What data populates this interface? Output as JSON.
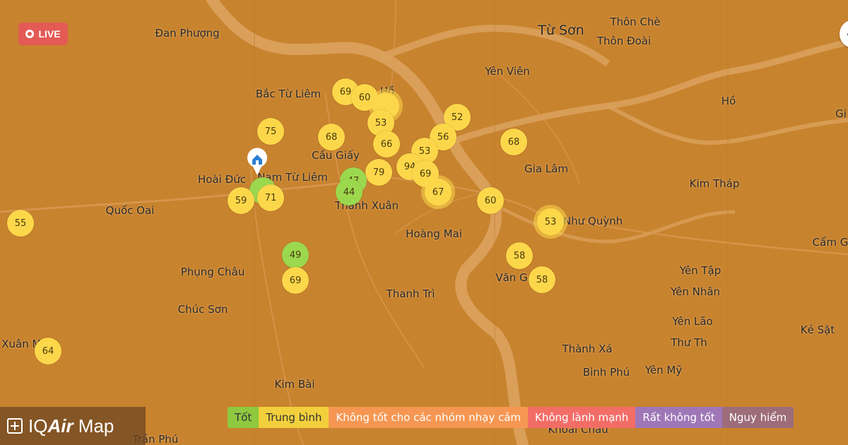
{
  "live_badge": "LIVE",
  "brand": {
    "iq": "IQ",
    "air": "Air",
    "map": " Map"
  },
  "colors": {
    "map_bg": "#c8832e",
    "river": "#dba25e",
    "good": "#9cd84e",
    "moderate": "#fdd74a",
    "usg": "#fe9b57",
    "unhealthy": "#fe6a69",
    "very_unhealthy": "#a97abc",
    "hazardous": "#a87383"
  },
  "legend": [
    {
      "label": "Tốt",
      "color": "#8ec93f",
      "text": "dark"
    },
    {
      "label": "Trung bình",
      "color": "#f2cf3c",
      "text": "dark"
    },
    {
      "label": "Không tốt cho các nhóm nhạy cảm",
      "color": "#f59752",
      "text": "light"
    },
    {
      "label": "Không lành mạnh",
      "color": "#f36d67",
      "text": "light"
    },
    {
      "label": "Rất không tốt",
      "color": "#9f77b7",
      "text": "light"
    },
    {
      "label": "Nguy hiểm",
      "color": "#9d6d7b",
      "text": "light"
    }
  ],
  "places": [
    {
      "name": "Đan Phượng",
      "big": false
    },
    {
      "name": "Bắc Từ Liêm",
      "big": false
    },
    {
      "name": "Hồ",
      "big": false
    },
    {
      "name": "Từ Sơn",
      "big": true
    },
    {
      "name": "Thôn Chè",
      "big": false
    },
    {
      "name": "Thôn Đoài",
      "big": false
    },
    {
      "name": "Yên Viên",
      "big": false
    },
    {
      "name": "Hồ",
      "big": false
    },
    {
      "name": "Gi",
      "big": false
    },
    {
      "name": "Cầu Giấy",
      "big": false
    },
    {
      "name": "Hoài Đức",
      "big": false
    },
    {
      "name": "Nam Từ Liêm",
      "big": false
    },
    {
      "name": "Gia Lâm",
      "big": false
    },
    {
      "name": "Kim Tháp",
      "big": false
    },
    {
      "name": "Quốc Oai",
      "big": false
    },
    {
      "name": "Thanh Xuân",
      "big": false
    },
    {
      "name": "Như Quỳnh",
      "big": false
    },
    {
      "name": "Hoàng Mai",
      "big": false
    },
    {
      "name": "Cẩm G",
      "big": false
    },
    {
      "name": "Phụng Châu",
      "big": false
    },
    {
      "name": "Văn G",
      "big": false
    },
    {
      "name": "Yên Tập",
      "big": false
    },
    {
      "name": "Thanh Trì",
      "big": false
    },
    {
      "name": "Yên Nhân",
      "big": false
    },
    {
      "name": "Chúc Sơn",
      "big": false
    },
    {
      "name": "Yên Lão",
      "big": false
    },
    {
      "name": "Kẻ Sặt",
      "big": false
    },
    {
      "name": "Thư Th",
      "big": false
    },
    {
      "name": "Xuân Mai",
      "big": false
    },
    {
      "name": "Thành Xá",
      "big": false
    },
    {
      "name": "Bình Phú",
      "big": false
    },
    {
      "name": "Yên Mỹ",
      "big": false
    },
    {
      "name": "Kim Bài",
      "big": false
    },
    {
      "name": "Khoái Châu",
      "big": false
    },
    {
      "name": "Trần Phú",
      "big": false
    }
  ],
  "stations": [
    {
      "aqi": "69",
      "level": "moderate"
    },
    {
      "aqi": "60",
      "level": "moderate"
    },
    {
      "aqi": "",
      "level": "moderate"
    },
    {
      "aqi": "53",
      "level": "moderate"
    },
    {
      "aqi": "52",
      "level": "moderate"
    },
    {
      "aqi": "56",
      "level": "moderate"
    },
    {
      "aqi": "75",
      "level": "moderate"
    },
    {
      "aqi": "68",
      "level": "moderate"
    },
    {
      "aqi": "66",
      "level": "moderate"
    },
    {
      "aqi": "53",
      "level": "moderate"
    },
    {
      "aqi": "68",
      "level": "moderate"
    },
    {
      "aqi": "94",
      "level": "moderate"
    },
    {
      "aqi": "69",
      "level": "moderate"
    },
    {
      "aqi": "79",
      "level": "moderate"
    },
    {
      "aqi": "47",
      "level": "good"
    },
    {
      "aqi": "44",
      "level": "good"
    },
    {
      "aqi": "67",
      "level": "moderate"
    },
    {
      "aqi": "",
      "level": "good"
    },
    {
      "aqi": "59",
      "level": "moderate"
    },
    {
      "aqi": "71",
      "level": "moderate"
    },
    {
      "aqi": "60",
      "level": "moderate"
    },
    {
      "aqi": "55",
      "level": "moderate"
    },
    {
      "aqi": "53",
      "level": "moderate"
    },
    {
      "aqi": "49",
      "level": "good"
    },
    {
      "aqi": "69",
      "level": "moderate"
    },
    {
      "aqi": "58",
      "level": "moderate"
    },
    {
      "aqi": "58",
      "level": "moderate"
    },
    {
      "aqi": "64",
      "level": "moderate"
    }
  ]
}
